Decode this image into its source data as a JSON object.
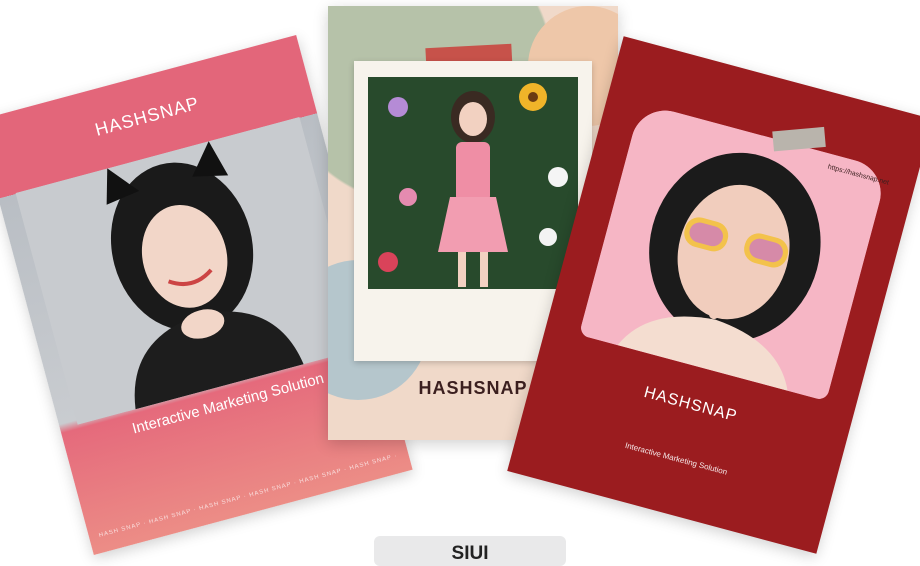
{
  "cards": {
    "left": {
      "brand": "HASHSNAP",
      "tagline": "Interactive Marketing Solution",
      "footer": "HASH SNAP · HASH SNAP · HASH SNAP · HASH SNAP · HASH SNAP · HASH SNAP · HASH SNAP"
    },
    "middle": {
      "brand": "HASHSNAP"
    },
    "right": {
      "brand": "HASHSNAP",
      "url": "https://hashsnap.net",
      "tagline": "Interactive Marketing Solution"
    }
  },
  "bottom_tab_label": "SIUI",
  "colors": {
    "left_accent": "#e3667a",
    "middle_bg": "#f0d9c9",
    "right_bg": "#9b1c1f"
  }
}
